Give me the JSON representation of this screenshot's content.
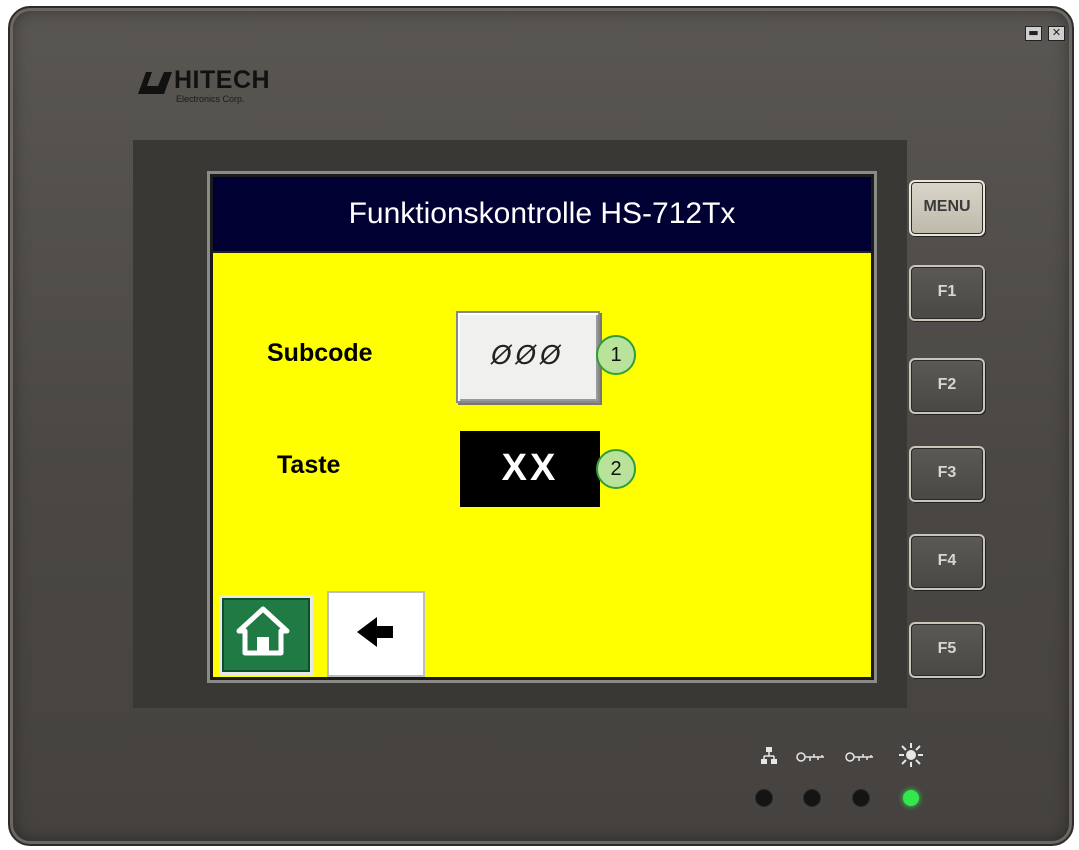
{
  "window_controls": {
    "minimize": "▬",
    "close": "✕"
  },
  "brand": {
    "name": "HITECH",
    "subtitle": "Electronics Corp."
  },
  "screen": {
    "title": "Funktionskontrolle HS-712Tx",
    "background_color": "#ffff00",
    "header_color": "#000033",
    "subcode": {
      "label": "Subcode",
      "value": "ØØØ",
      "badge": "1"
    },
    "taste": {
      "label": "Taste",
      "value": "XX",
      "badge": "2"
    },
    "buttons": {
      "home": "home-icon",
      "back": "arrow-left-icon"
    }
  },
  "side_keys": [
    "MENU",
    "F1",
    "F2",
    "F3",
    "F4",
    "F5"
  ],
  "status_panel": {
    "icons": [
      "network-icon",
      "key-icon",
      "key-icon",
      "light-icon"
    ],
    "leds": [
      {
        "name": "network-led",
        "on": false
      },
      {
        "name": "key1-led",
        "on": false
      },
      {
        "name": "key2-led",
        "on": false
      },
      {
        "name": "power-led",
        "on": true,
        "color": "#32e84a"
      }
    ]
  }
}
